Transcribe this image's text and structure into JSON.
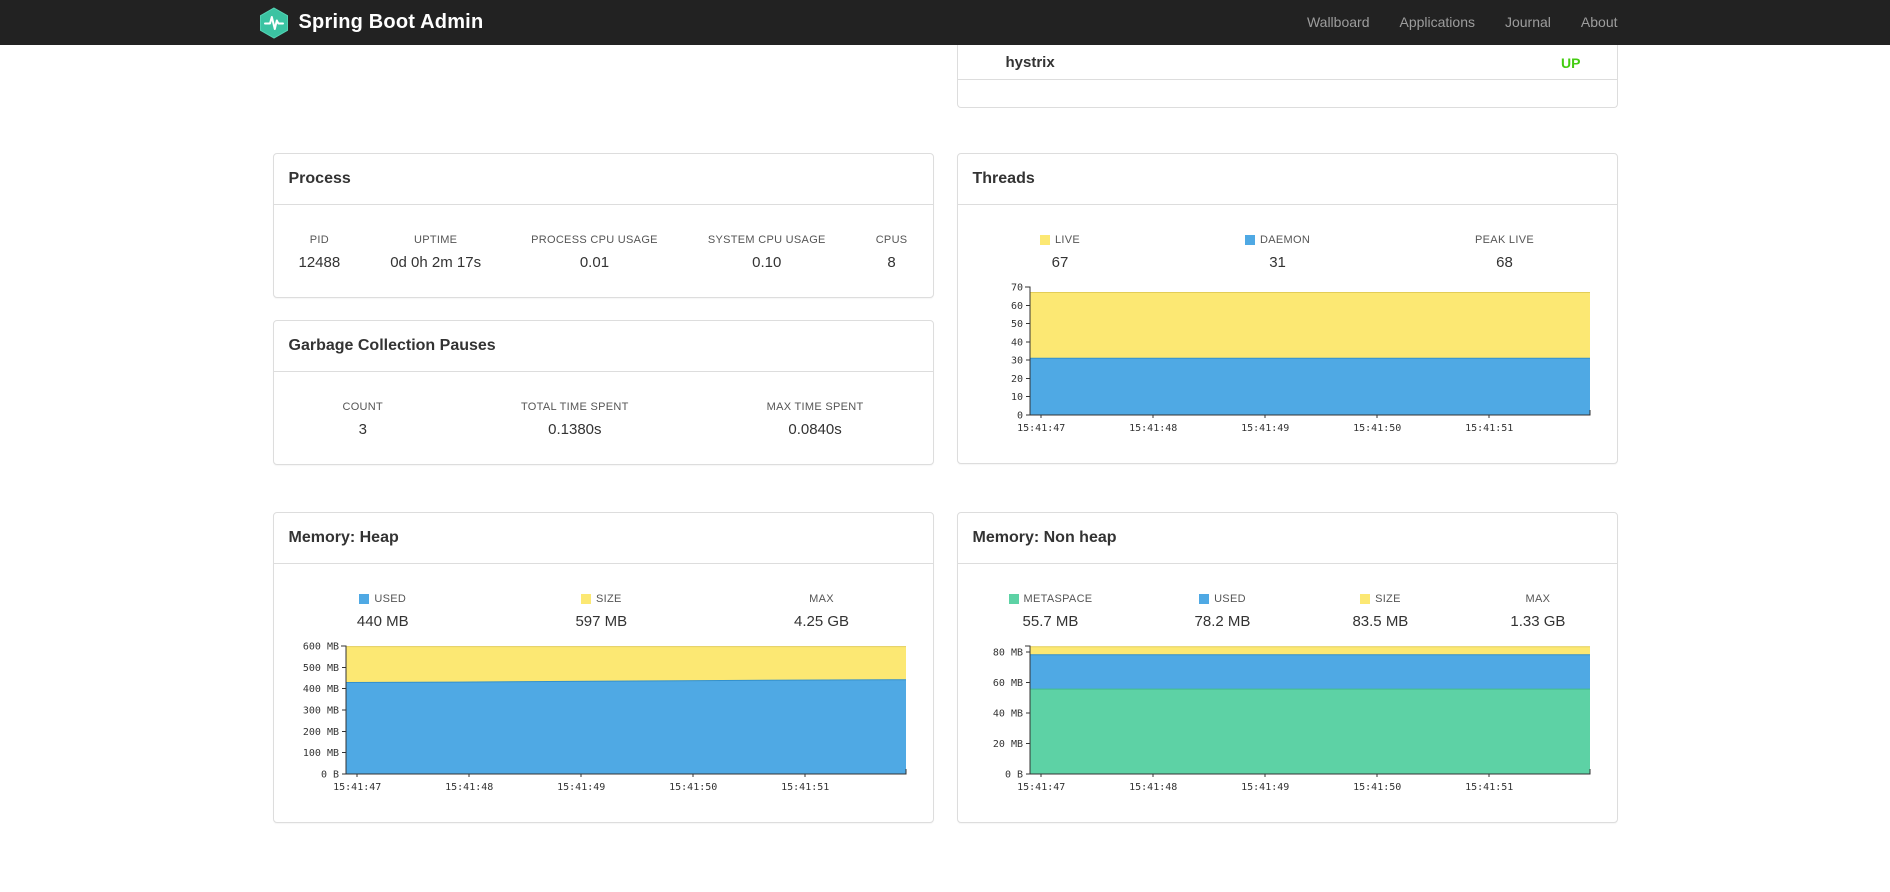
{
  "navbar": {
    "brand": "Spring Boot Admin",
    "links": [
      {
        "label": "Wallboard"
      },
      {
        "label": "Applications"
      },
      {
        "label": "Journal"
      },
      {
        "label": "About"
      }
    ]
  },
  "health": {
    "service_name": "hystrix",
    "service_status": "UP",
    "status_color": "#44cc11"
  },
  "panels": {
    "process": {
      "title": "Process",
      "metrics": [
        {
          "label": "PID",
          "value": "12488"
        },
        {
          "label": "UPTIME",
          "value": "0d 0h 2m 17s"
        },
        {
          "label": "PROCESS CPU USAGE",
          "value": "0.01"
        },
        {
          "label": "SYSTEM CPU USAGE",
          "value": "0.10"
        },
        {
          "label": "CPUS",
          "value": "8"
        }
      ]
    },
    "gc": {
      "title": "Garbage Collection Pauses",
      "metrics": [
        {
          "label": "COUNT",
          "value": "3"
        },
        {
          "label": "TOTAL TIME SPENT",
          "value": "0.1380s"
        },
        {
          "label": "MAX TIME SPENT",
          "value": "0.0840s"
        }
      ]
    },
    "threads": {
      "title": "Threads",
      "metrics": [
        {
          "label": "LIVE",
          "value": "67",
          "color": "#fce873"
        },
        {
          "label": "DAEMON",
          "value": "31",
          "color": "#4fa9e4"
        },
        {
          "label": "PEAK LIVE",
          "value": "68"
        }
      ]
    },
    "heap": {
      "title": "Memory: Heap",
      "metrics": [
        {
          "label": "USED",
          "value": "440 MB",
          "color": "#4fa9e4"
        },
        {
          "label": "SIZE",
          "value": "597 MB",
          "color": "#fce873"
        },
        {
          "label": "MAX",
          "value": "4.25 GB"
        }
      ]
    },
    "nonheap": {
      "title": "Memory: Non heap",
      "metrics": [
        {
          "label": "METASPACE",
          "value": "55.7 MB",
          "color": "#5dd2a5"
        },
        {
          "label": "USED",
          "value": "78.2 MB",
          "color": "#4fa9e4"
        },
        {
          "label": "SIZE",
          "value": "83.5 MB",
          "color": "#fce873"
        },
        {
          "label": "MAX",
          "value": "1.33 GB"
        }
      ]
    }
  },
  "chart_data": [
    {
      "id": "threads",
      "type": "area",
      "title": "Threads",
      "x_labels": [
        "15:41:47",
        "15:41:48",
        "15:41:49",
        "15:41:50",
        "15:41:51"
      ],
      "ylim": [
        0,
        70
      ],
      "y_tick_values": [
        0,
        10,
        20,
        30,
        40,
        50,
        60,
        70
      ],
      "y_tick_labels": [
        "0",
        "10",
        "20",
        "30",
        "40",
        "50",
        "60",
        "70"
      ],
      "grid": false,
      "legend_position": "top",
      "series": [
        {
          "name": "LIVE",
          "color": "#fce873",
          "stroke": "#e3cd57",
          "values": [
            67,
            67,
            67,
            67,
            67,
            67
          ]
        },
        {
          "name": "DAEMON",
          "color": "#4fa9e4",
          "stroke": "#3390cc",
          "values": [
            31,
            31,
            31,
            31,
            31,
            31
          ]
        }
      ]
    },
    {
      "id": "heap",
      "type": "area",
      "title": "Memory: Heap",
      "x_labels": [
        "15:41:47",
        "15:41:48",
        "15:41:49",
        "15:41:50",
        "15:41:51"
      ],
      "ylim": [
        0,
        600
      ],
      "y_tick_values": [
        0,
        100,
        200,
        300,
        400,
        500,
        600
      ],
      "y_tick_labels": [
        "0 B",
        "100 MB",
        "200 MB",
        "300 MB",
        "400 MB",
        "500 MB",
        "600 MB"
      ],
      "grid": false,
      "legend_position": "top",
      "series": [
        {
          "name": "SIZE",
          "color": "#fce873",
          "stroke": "#e3cd57",
          "values": [
            597,
            597,
            597,
            597,
            597,
            597
          ]
        },
        {
          "name": "USED",
          "color": "#4fa9e4",
          "stroke": "#3390cc",
          "values": [
            429,
            431,
            434,
            437,
            440,
            442
          ]
        }
      ]
    },
    {
      "id": "nonheap",
      "type": "area",
      "title": "Memory: Non heap",
      "x_labels": [
        "15:41:47",
        "15:41:48",
        "15:41:49",
        "15:41:50",
        "15:41:51"
      ],
      "ylim": [
        0,
        84
      ],
      "y_tick_values": [
        0,
        20,
        40,
        60,
        80
      ],
      "y_tick_labels": [
        "0 B",
        "20 MB",
        "40 MB",
        "60 MB",
        "80 MB"
      ],
      "grid": false,
      "legend_position": "top",
      "series": [
        {
          "name": "SIZE",
          "color": "#fce873",
          "stroke": "#e3cd57",
          "values": [
            83.5,
            83.5,
            83.5,
            83.5,
            83.5,
            83.5
          ]
        },
        {
          "name": "USED",
          "color": "#4fa9e4",
          "stroke": "#3390cc",
          "values": [
            78.2,
            78.2,
            78.2,
            78.2,
            78.2,
            78.2
          ]
        },
        {
          "name": "METASPACE",
          "color": "#5dd2a5",
          "stroke": "#43bd8d",
          "values": [
            55.7,
            55.7,
            55.7,
            55.7,
            55.7,
            55.7
          ]
        }
      ]
    }
  ]
}
